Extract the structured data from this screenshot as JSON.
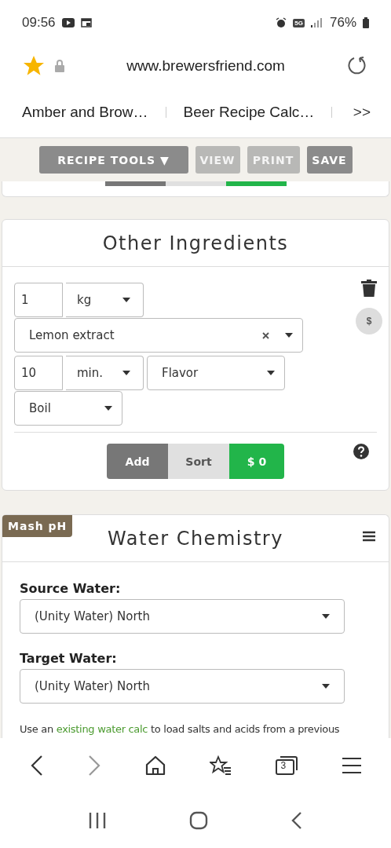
{
  "status_bar": {
    "time": "09:56",
    "network": "5G",
    "battery": "76%"
  },
  "address_bar": {
    "url": "www.brewersfriend.com",
    "bookmarked": true
  },
  "browser_tabs": [
    {
      "label": "Amber and Brow…"
    },
    {
      "label": "Beer Recipe Calc…"
    }
  ],
  "tabs_more": ">>",
  "toolbar": [
    {
      "label": "RECIPE TOOLS ▼",
      "disabled": false
    },
    {
      "label": "VIEW",
      "disabled": true
    },
    {
      "label": "PRINT",
      "disabled": true
    },
    {
      "label": "SAVE",
      "disabled": false
    }
  ],
  "other_ingredients": {
    "title": "Other Ingredients",
    "amount": "1",
    "unit": "kg",
    "name": "Lemon extract",
    "time": "10",
    "time_unit": "min.",
    "use": "Flavor",
    "stage": "Boil",
    "cost_button": "$",
    "actions": [
      {
        "label": "Add",
        "kind": "dark"
      },
      {
        "label": "Sort",
        "kind": "light"
      },
      {
        "label": "$ 0",
        "kind": "green"
      }
    ]
  },
  "water_chemistry": {
    "badge": "Mash pH",
    "title": "Water Chemistry",
    "fields": [
      {
        "label": "Source Water:",
        "value": "(Unity Water) North"
      },
      {
        "label": "Target Water:",
        "value": "(Unity Water) North"
      }
    ],
    "note_before": "Use an",
    "note_link": "existing water calc",
    "note_after": "to load salts and acids from a previous"
  },
  "bottom_nav": {
    "tab_count": "3"
  }
}
